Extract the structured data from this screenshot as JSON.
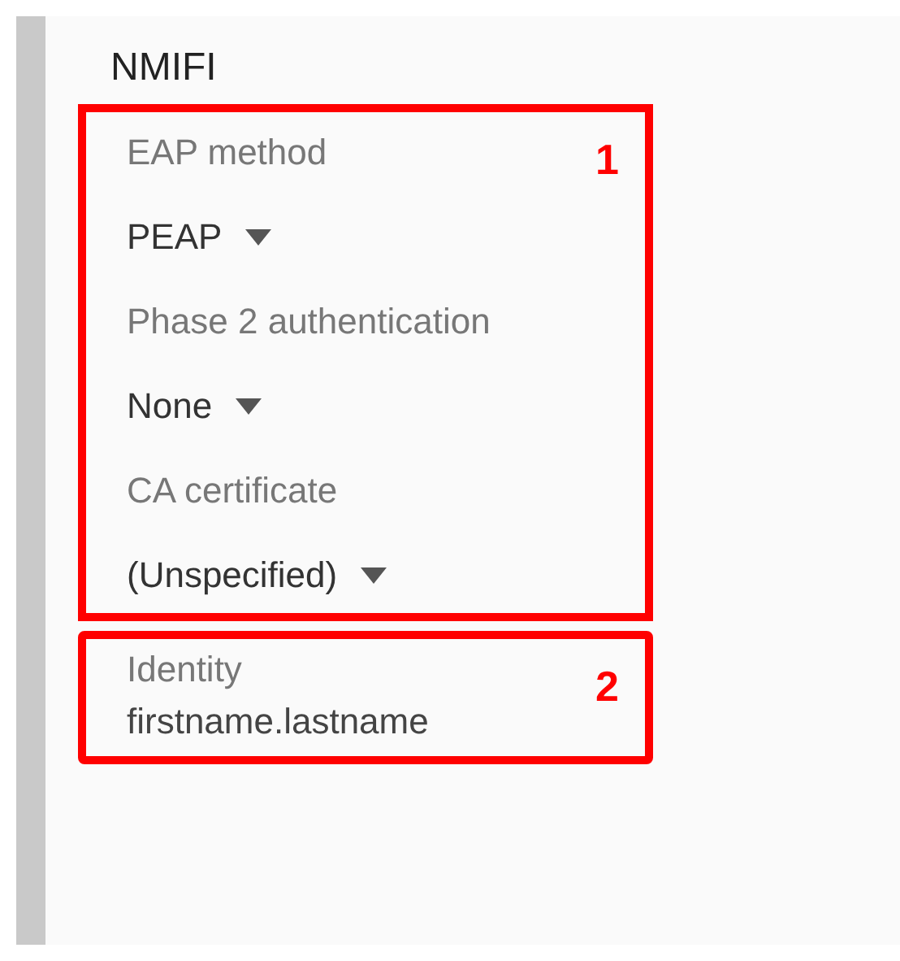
{
  "title": "NMIFI",
  "sections": [
    {
      "number": "1",
      "fields": [
        {
          "kind": "dropdown",
          "label": "EAP method",
          "value": "PEAP"
        },
        {
          "kind": "dropdown",
          "label": "Phase 2 authentication",
          "value": "None"
        },
        {
          "kind": "dropdown",
          "label": "CA certificate",
          "value": "(Unspecified)"
        }
      ]
    },
    {
      "number": "2",
      "fields": [
        {
          "kind": "text",
          "label": "Identity",
          "value": "firstname.lastname"
        }
      ]
    }
  ]
}
